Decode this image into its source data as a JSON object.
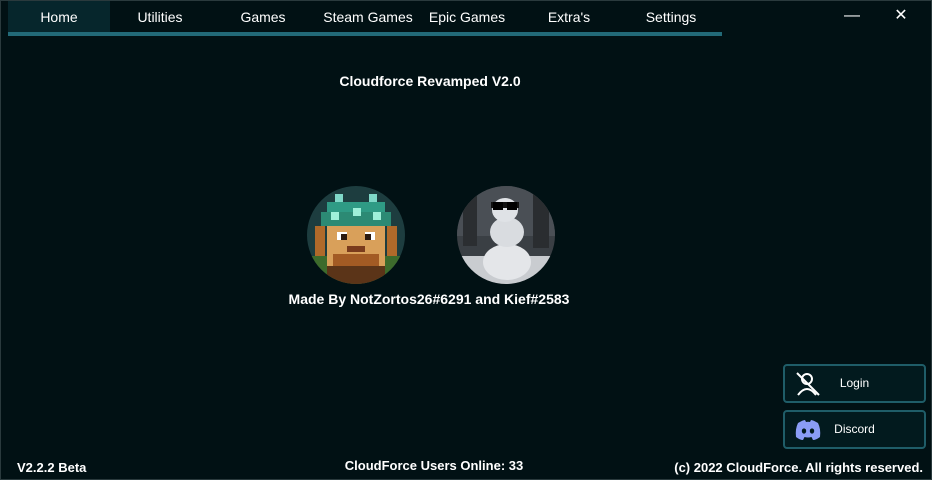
{
  "nav": {
    "tabs": [
      {
        "label": "Home",
        "active": true
      },
      {
        "label": "Utilities",
        "active": false
      },
      {
        "label": "Games",
        "active": false
      },
      {
        "label": "Steam Games",
        "active": false
      },
      {
        "label": "Epic Games",
        "active": false
      },
      {
        "label": "Extra's",
        "active": false
      },
      {
        "label": "Settings",
        "active": false
      }
    ]
  },
  "window_controls": {
    "minimize": "—",
    "close": "✕"
  },
  "main": {
    "title": "Cloudforce Revamped V2.0",
    "made_by": "Made By NotZortos26#6291 and Kief#2583"
  },
  "side_buttons": {
    "login": "Login",
    "discord": "Discord"
  },
  "footer": {
    "version": "V2.2.2 Beta",
    "users_online": "CloudForce Users Online: 33",
    "copyright": "(c) 2022 CloudForce. All rights reserved."
  },
  "colors": {
    "background": "#011114",
    "accent": "#226a78",
    "active_tab": "#06262c"
  }
}
